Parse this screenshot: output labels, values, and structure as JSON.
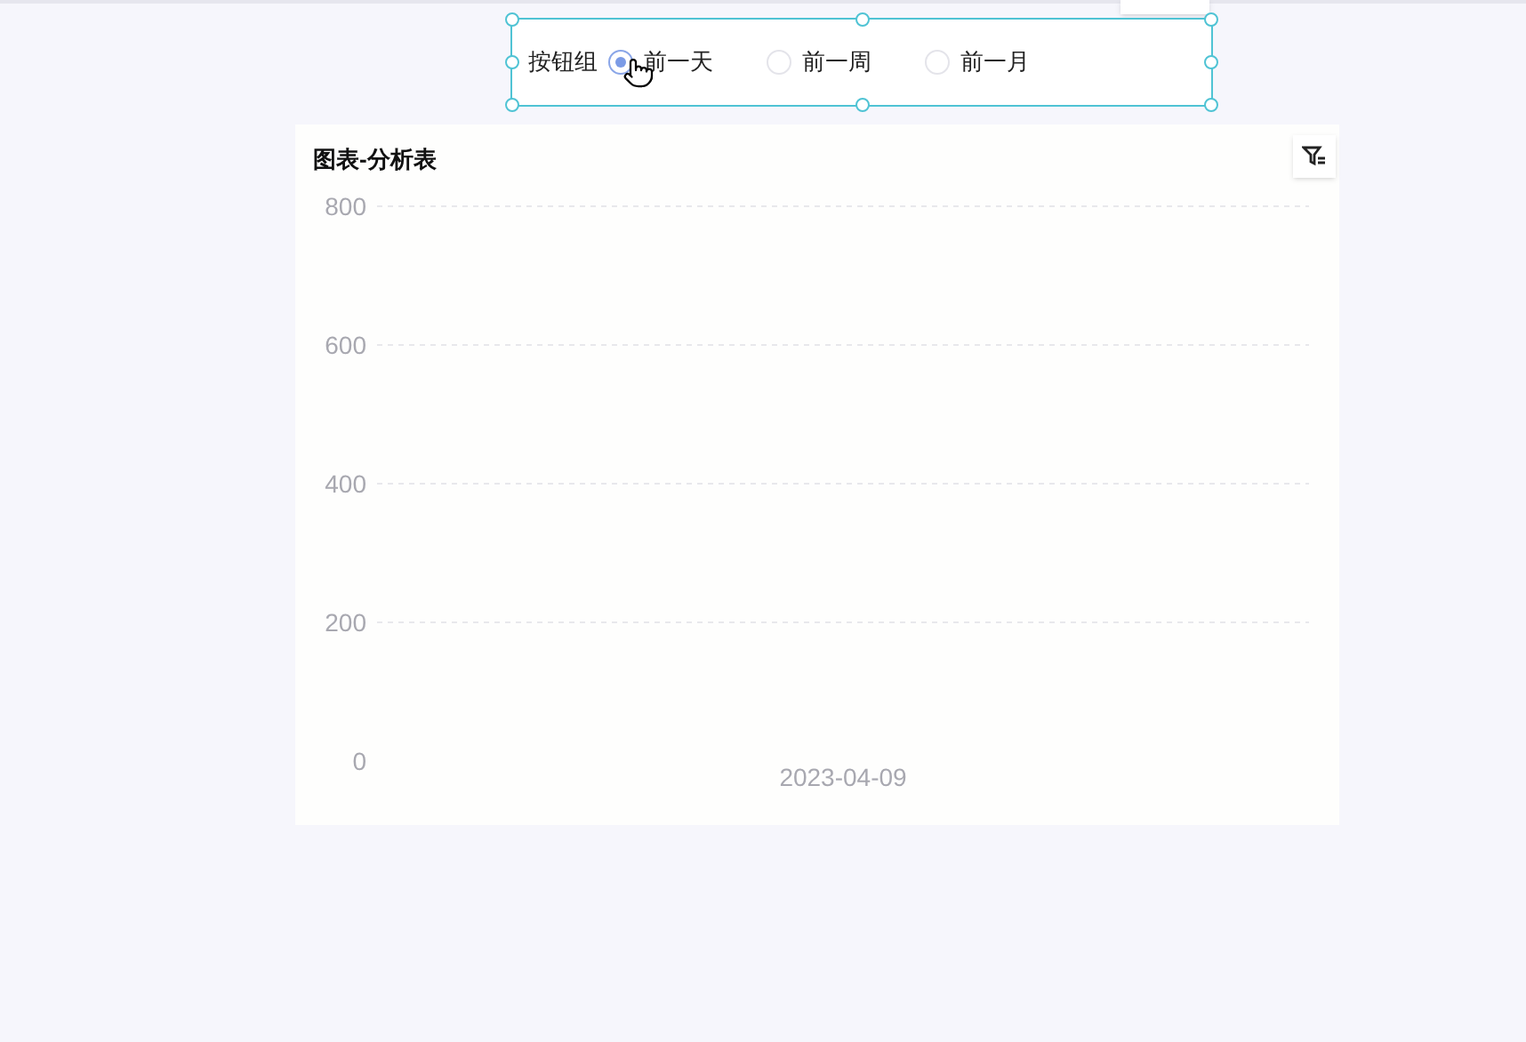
{
  "button_group": {
    "label": "按钮组",
    "options": [
      {
        "label": "前一天",
        "selected": true
      },
      {
        "label": "前一周",
        "selected": false
      },
      {
        "label": "前一月",
        "selected": false
      }
    ]
  },
  "chart_card": {
    "title": "图表-分析表",
    "chart_data": {
      "type": "bar",
      "categories": [
        "2023-04-09"
      ],
      "values": [
        null
      ],
      "grid": true,
      "ylim": [
        0,
        800
      ],
      "yticks": [
        0,
        200,
        400,
        600,
        800
      ]
    }
  }
}
